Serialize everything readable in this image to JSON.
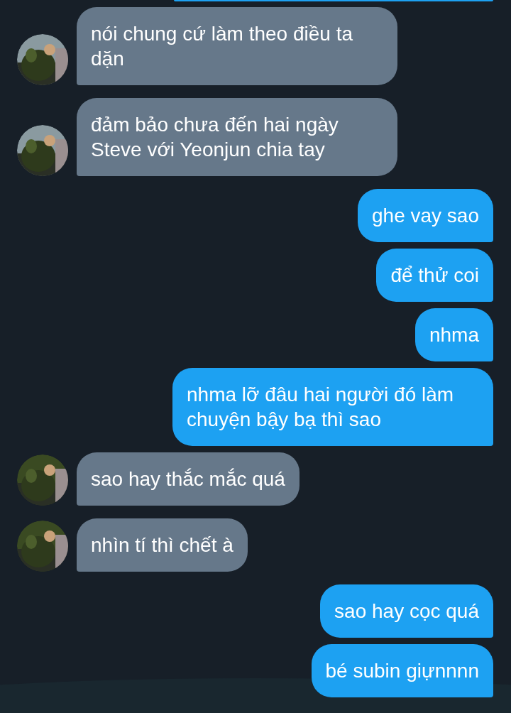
{
  "messages": [
    {
      "kind": "cutoff",
      "outgoing": true
    },
    {
      "kind": "text",
      "outgoing": false,
      "text": "nói chung cứ làm theo điều ta dặn"
    },
    {
      "kind": "text",
      "outgoing": false,
      "text": "đảm bảo chưa đến hai ngày Steve với Yeonjun chia tay"
    },
    {
      "kind": "text",
      "outgoing": true,
      "text": "ghe vay sao"
    },
    {
      "kind": "text",
      "outgoing": true,
      "text": "để thử coi"
    },
    {
      "kind": "text",
      "outgoing": true,
      "text": "nhma"
    },
    {
      "kind": "text",
      "outgoing": true,
      "text": "nhma lỡ đâu hai người đó làm chuyện bậy bạ thì sao"
    },
    {
      "kind": "text",
      "outgoing": false,
      "text": "sao hay thắc mắc quá"
    },
    {
      "kind": "text",
      "outgoing": false,
      "text": "nhìn tí thì chết à"
    },
    {
      "kind": "text",
      "outgoing": true,
      "text": "sao hay cọc quá"
    },
    {
      "kind": "text",
      "outgoing": true,
      "text": "bé subin giựnnnn"
    }
  ]
}
